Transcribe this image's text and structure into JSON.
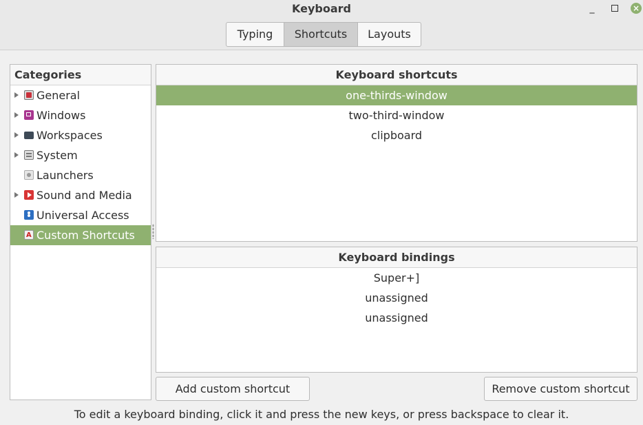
{
  "window": {
    "title": "Keyboard",
    "minimize_symbol": "_",
    "close_symbol": "×"
  },
  "tabs": [
    {
      "label": "Typing",
      "active": false
    },
    {
      "label": "Shortcuts",
      "active": true
    },
    {
      "label": "Layouts",
      "active": false
    }
  ],
  "categories": {
    "header": "Categories",
    "items": [
      {
        "label": "General",
        "icon": "general-icon",
        "expandable": true
      },
      {
        "label": "Windows",
        "icon": "windows-icon",
        "expandable": true
      },
      {
        "label": "Workspaces",
        "icon": "workspaces-icon",
        "expandable": true
      },
      {
        "label": "System",
        "icon": "system-icon",
        "expandable": true
      },
      {
        "label": "Launchers",
        "icon": "launchers-icon",
        "expandable": false
      },
      {
        "label": "Sound and Media",
        "icon": "sound-media-icon",
        "expandable": true
      },
      {
        "label": "Universal Access",
        "icon": "universal-access-icon",
        "expandable": false
      },
      {
        "label": "Custom Shortcuts",
        "icon": "custom-shortcuts-icon",
        "expandable": false,
        "selected": true
      }
    ]
  },
  "shortcuts": {
    "header": "Keyboard shortcuts",
    "rows": [
      {
        "label": "one-thirds-window",
        "selected": true
      },
      {
        "label": "two-third-window",
        "selected": false
      },
      {
        "label": "clipboard",
        "selected": false
      }
    ]
  },
  "bindings": {
    "header": "Keyboard bindings",
    "rows": [
      "Super+]",
      "unassigned",
      "unassigned"
    ]
  },
  "buttons": {
    "add": "Add custom shortcut",
    "remove": "Remove custom shortcut"
  },
  "hint": "To edit a keyboard binding, click it and press the new keys, or press backspace to clear it.",
  "colors": {
    "selection": "#8fb170"
  }
}
